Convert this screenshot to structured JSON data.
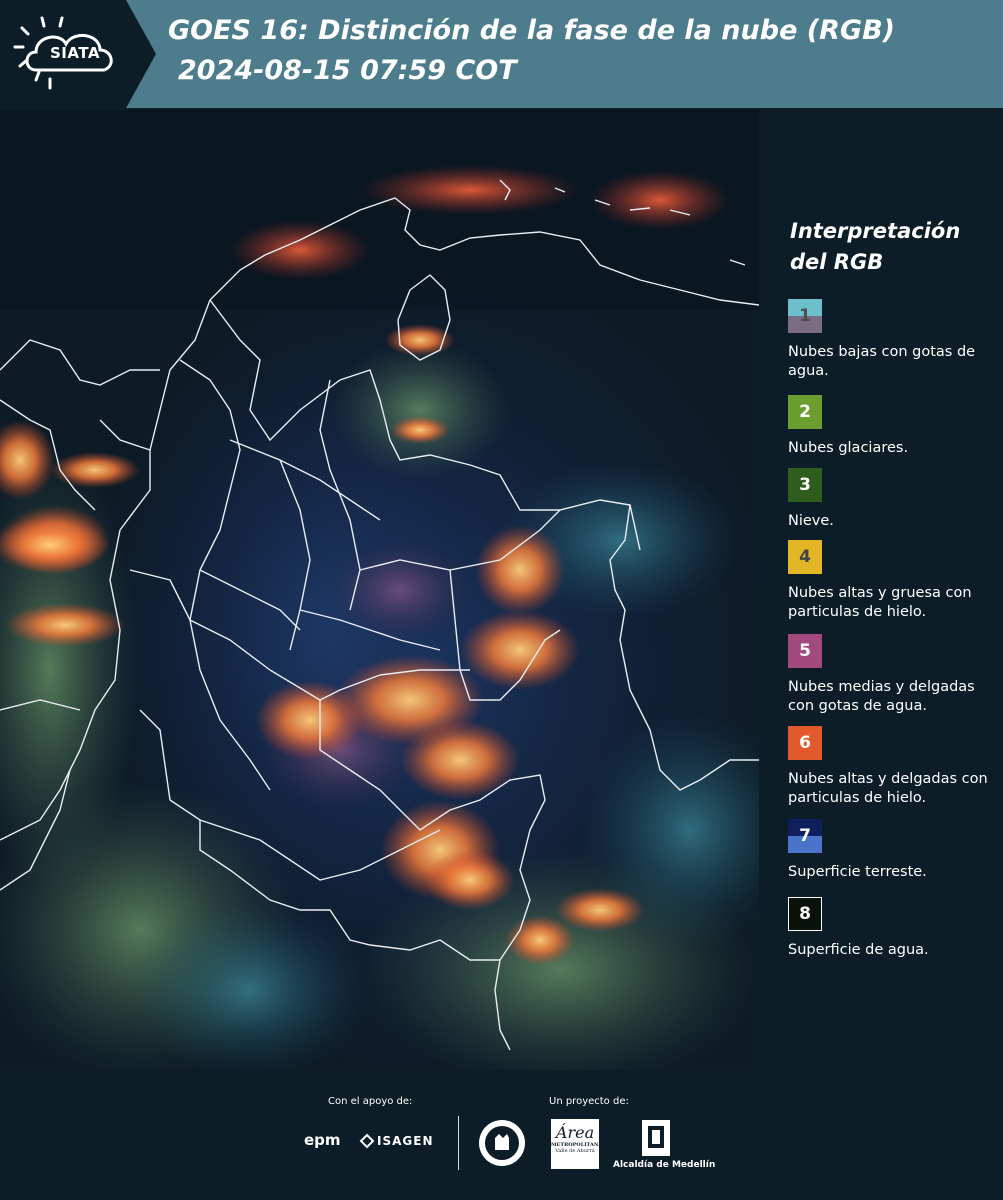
{
  "header": {
    "logo_text": "SIATA",
    "title": "GOES 16: Distinción de la fase de la nube (RGB)",
    "datetime": "2024-08-15 07:59 COT",
    "background_color": "#4d7c8c",
    "logo_background_color": "#0c1d28"
  },
  "legend": {
    "title_line1": "Interpretación",
    "title_line2": "del RGB",
    "items": [
      {
        "number": "1",
        "label": "Nubes bajas con gotas de agua.",
        "color_top": "#6cc0cc",
        "color_bottom": "#7b6b83"
      },
      {
        "number": "2",
        "label": "Nubes glaciares.",
        "color": "#6b9e2f"
      },
      {
        "number": "3",
        "label": "Nieve.",
        "color": "#2f5d1e"
      },
      {
        "number": "4",
        "label": "Nubes altas y gruesa con particulas de hielo.",
        "color": "#e2b627"
      },
      {
        "number": "5",
        "label": "Nubes medias y delgadas con gotas de agua.",
        "color": "#a3497f"
      },
      {
        "number": "6",
        "label": "Nubes altas y delgadas con particulas de hielo.",
        "color": "#e25a2b"
      },
      {
        "number": "7",
        "label": "Superficie terreste.",
        "color_top": "#0f1f5c",
        "color_bottom": "#4a74c9"
      },
      {
        "number": "8",
        "label": "Superficie de agua.",
        "color": "#0b120b"
      }
    ]
  },
  "footer": {
    "support_label": "Con el apoyo de:",
    "project_label": "Un proyecto de:",
    "sponsors": [
      "epm",
      "ISAGEN"
    ],
    "partners": [
      "Área Metropolitana Valle de Aburrá",
      "Alcaldía de Medellín"
    ],
    "metro_text_top": "Área",
    "metro_text_mid": "METROPOLITANA",
    "metro_text_bottom": "Valle de Aburrá"
  }
}
